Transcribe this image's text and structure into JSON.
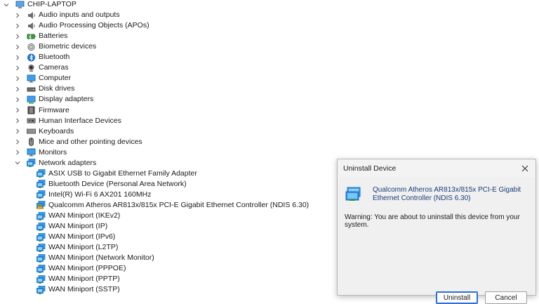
{
  "tree": {
    "root": "CHIP-LAPTOP",
    "categories": [
      {
        "label": "Audio inputs and outputs",
        "icon": "speaker-icon"
      },
      {
        "label": "Audio Processing Objects (APOs)",
        "icon": "speaker-icon"
      },
      {
        "label": "Batteries",
        "icon": "battery-icon"
      },
      {
        "label": "Biometric devices",
        "icon": "biometric-icon"
      },
      {
        "label": "Bluetooth",
        "icon": "bluetooth-icon"
      },
      {
        "label": "Cameras",
        "icon": "camera-icon"
      },
      {
        "label": "Computer",
        "icon": "monitor-icon"
      },
      {
        "label": "Disk drives",
        "icon": "disk-drive-icon"
      },
      {
        "label": "Display adapters",
        "icon": "display-adapter-icon"
      },
      {
        "label": "Firmware",
        "icon": "firmware-icon"
      },
      {
        "label": "Human Interface Devices",
        "icon": "hid-icon"
      },
      {
        "label": "Keyboards",
        "icon": "keyboard-icon"
      },
      {
        "label": "Mice and other pointing devices",
        "icon": "mouse-icon"
      },
      {
        "label": "Monitors",
        "icon": "monitor-icon"
      },
      {
        "label": "Network adapters",
        "icon": "network-adapter-icon"
      }
    ],
    "network_adapters": [
      {
        "label": "ASIX USB to Gigabit Ethernet Family Adapter",
        "icon": "network-adapter-icon"
      },
      {
        "label": "Bluetooth Device (Personal Area Network)",
        "icon": "network-adapter-icon"
      },
      {
        "label": "Intel(R) Wi-Fi 6 AX201 160MHz",
        "icon": "network-adapter-icon"
      },
      {
        "label": "Qualcomm Atheros AR813x/815x PCI-E Gigabit Ethernet Controller (NDIS 6.30)",
        "icon": "network-adapter-warning-icon"
      },
      {
        "label": "WAN Miniport (IKEv2)",
        "icon": "network-adapter-icon"
      },
      {
        "label": "WAN Miniport (IP)",
        "icon": "network-adapter-icon"
      },
      {
        "label": "WAN Miniport (IPv6)",
        "icon": "network-adapter-icon"
      },
      {
        "label": "WAN Miniport (L2TP)",
        "icon": "network-adapter-icon"
      },
      {
        "label": "WAN Miniport (Network Monitor)",
        "icon": "network-adapter-icon"
      },
      {
        "label": "WAN Miniport (PPPOE)",
        "icon": "network-adapter-icon"
      },
      {
        "label": "WAN Miniport (PPTP)",
        "icon": "network-adapter-icon"
      },
      {
        "label": "WAN Miniport (SSTP)",
        "icon": "network-adapter-icon"
      }
    ]
  },
  "dialog": {
    "title": "Uninstall Device",
    "device_name": "Qualcomm Atheros AR813x/815x PCI-E Gigabit Ethernet Controller (NDIS 6.30)",
    "warning": "Warning: You are about to uninstall this device from your system.",
    "uninstall_label": "Uninstall",
    "cancel_label": "Cancel"
  },
  "colors": {
    "accent": "#2f6fd6",
    "device_link": "#1a3c7a",
    "network_icon": "#2a8ee8",
    "warning_icon": "#f2c21b"
  }
}
